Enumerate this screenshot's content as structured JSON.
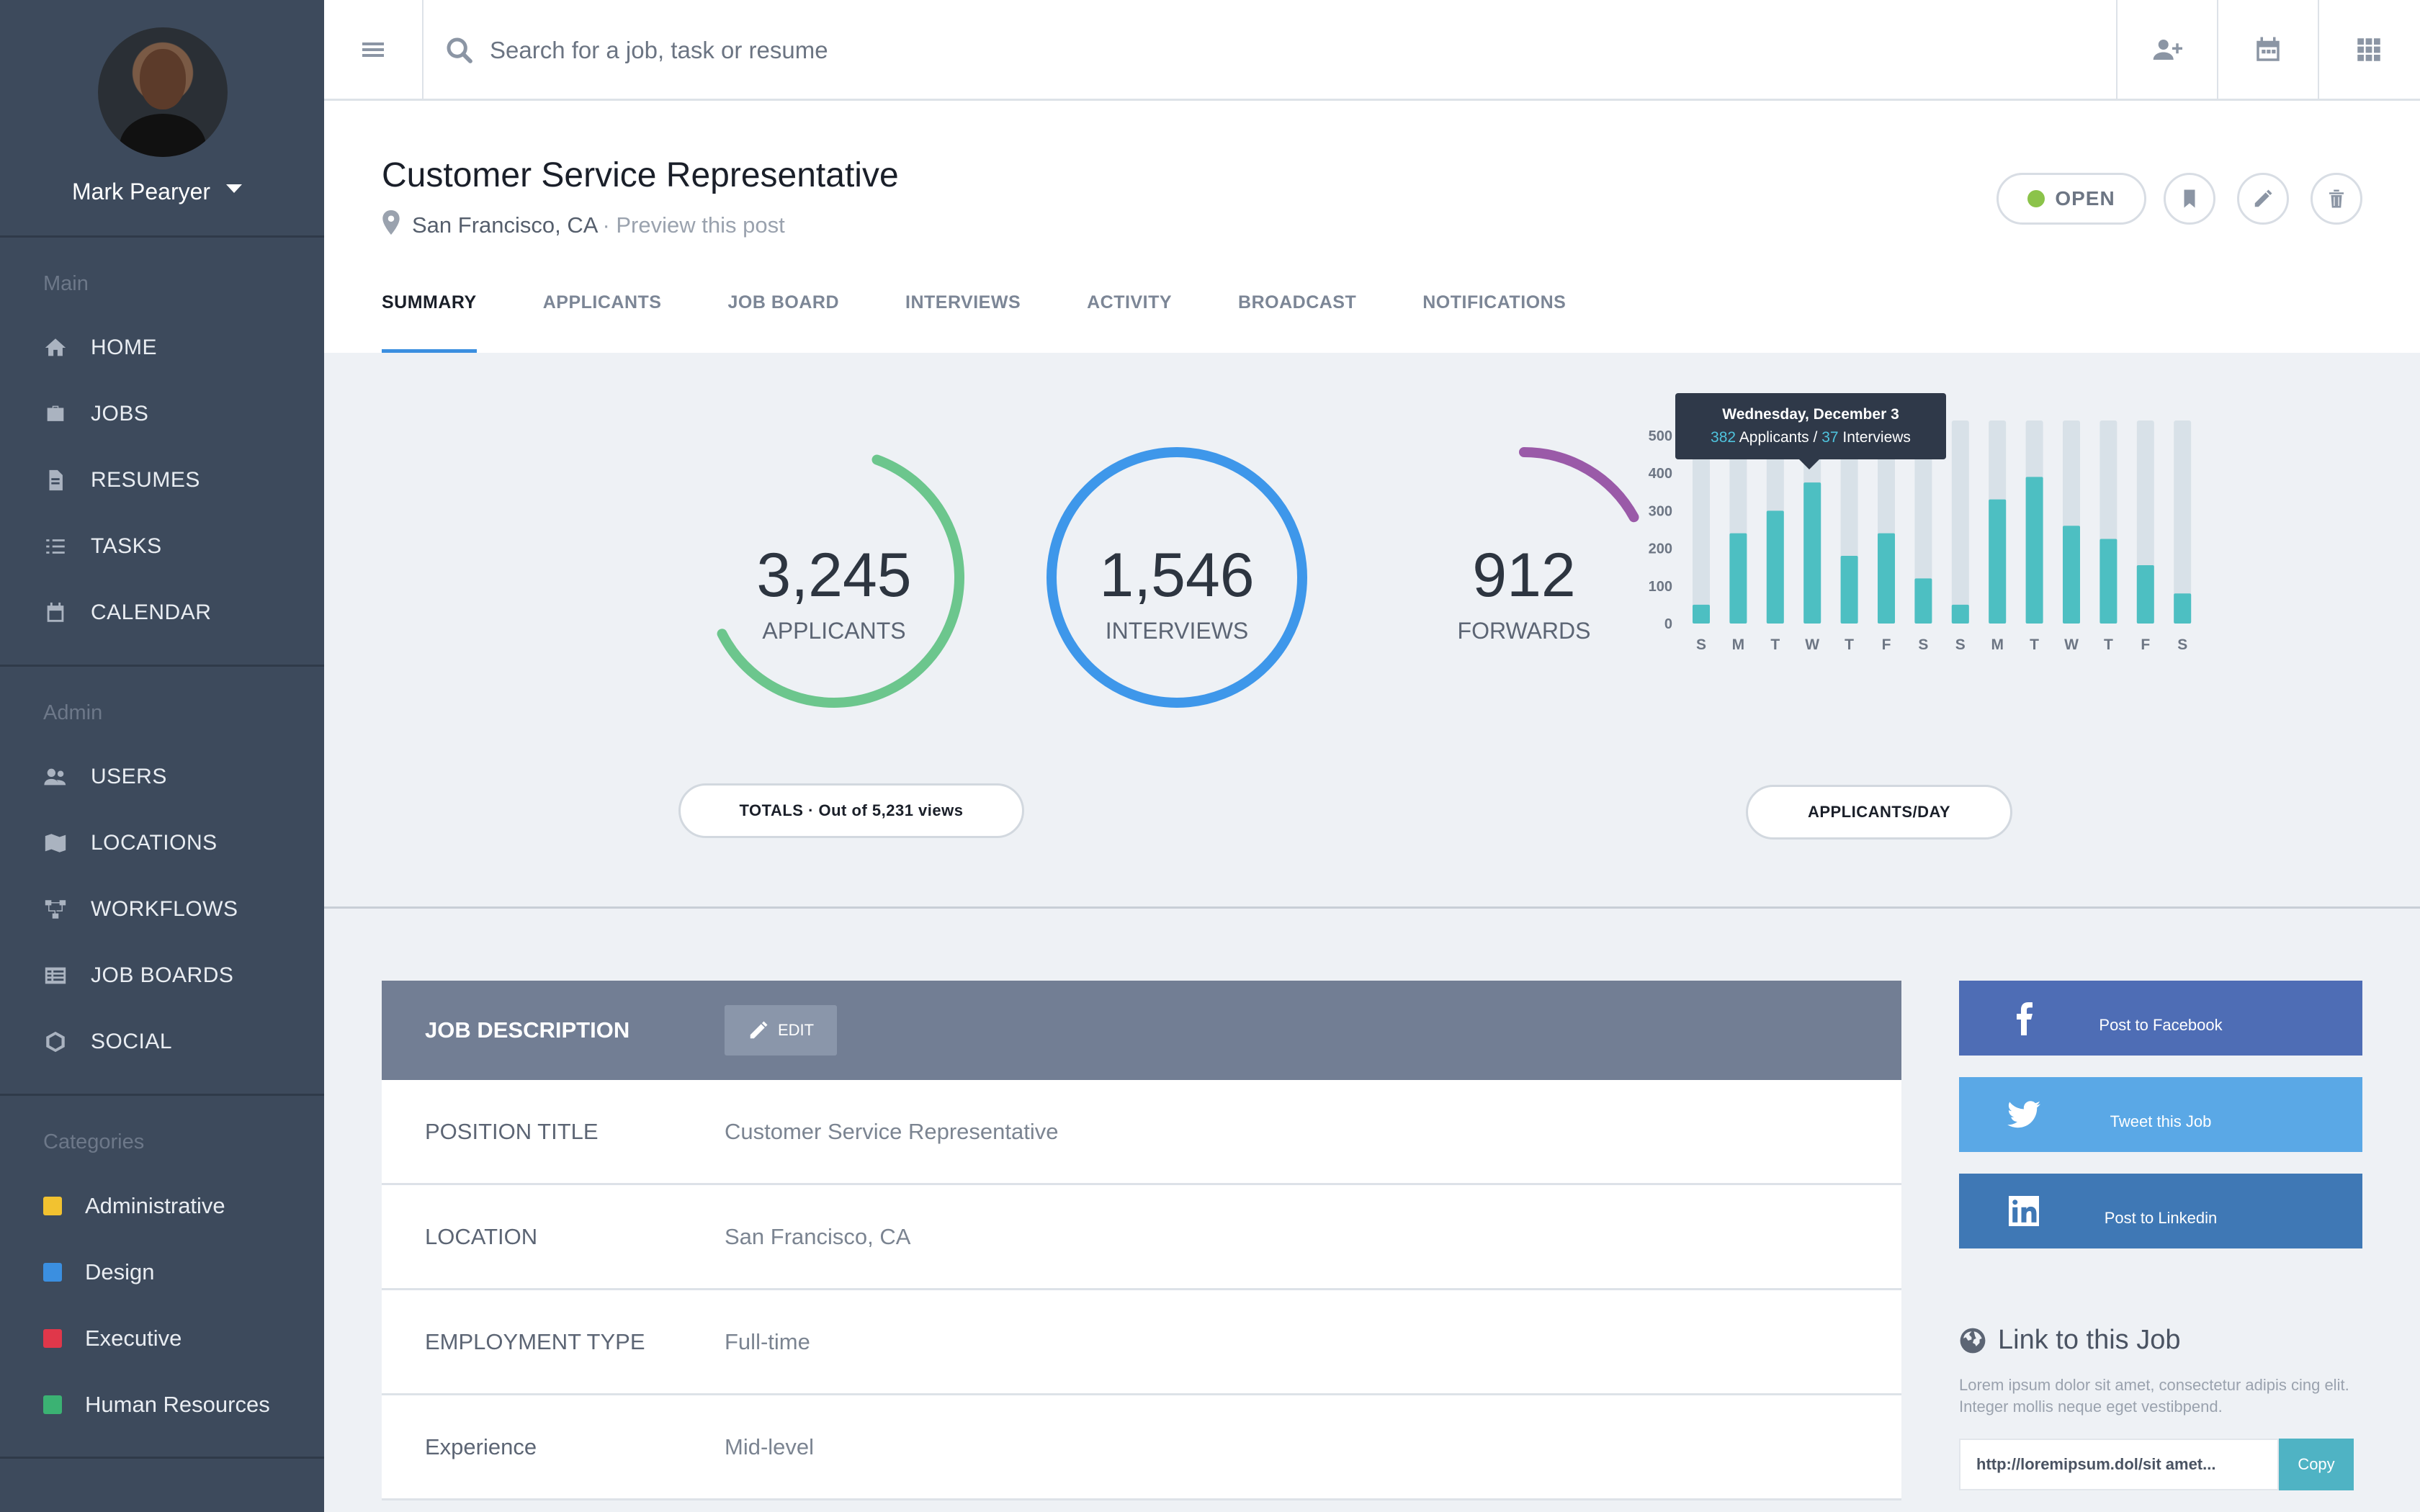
{
  "sidebar": {
    "user_name": "Mark Pearyer",
    "sections": [
      {
        "heading": "Main",
        "items": [
          {
            "label": "HOME",
            "icon": "home-icon"
          },
          {
            "label": "JOBS",
            "icon": "briefcase-icon"
          },
          {
            "label": "RESUMES",
            "icon": "document-icon"
          },
          {
            "label": "TASKS",
            "icon": "checklist-icon"
          },
          {
            "label": "CALENDAR",
            "icon": "calendar-icon"
          }
        ]
      },
      {
        "heading": "Admin",
        "items": [
          {
            "label": "USERS",
            "icon": "users-icon"
          },
          {
            "label": "LOCATIONS",
            "icon": "map-icon"
          },
          {
            "label": "WORKFLOWS",
            "icon": "workflow-icon"
          },
          {
            "label": "JOB BOARDS",
            "icon": "board-icon"
          },
          {
            "label": "SOCIAL",
            "icon": "social-icon"
          }
        ]
      }
    ],
    "categories": {
      "heading": "Categories",
      "items": [
        {
          "label": "Administrative",
          "color": "#f2c230"
        },
        {
          "label": "Design",
          "color": "#3b8fe0"
        },
        {
          "label": "Executive",
          "color": "#e0374a"
        },
        {
          "label": "Human Resources",
          "color": "#3bb273"
        }
      ]
    }
  },
  "topbar": {
    "search_placeholder": "Search for a job, task or resume",
    "actions": [
      "add-user-icon",
      "calendar-icon",
      "apps-grid-icon"
    ]
  },
  "header": {
    "title": "Customer Service Representative",
    "location": "San Francisco, CA",
    "preview_link": "· Preview this post",
    "status": "OPEN",
    "status_color": "#8bc34a",
    "tabs": [
      "SUMMARY",
      "APPLICANTS",
      "JOB BOARD",
      "INTERVIEWS",
      "ACTIVITY",
      "BROADCAST",
      "NOTIFICATIONS"
    ],
    "active_tab": "SUMMARY"
  },
  "stats": {
    "applicants": {
      "value": "3,245",
      "label": "APPLICANTS",
      "fraction": 0.62,
      "color": "#6cc68d"
    },
    "interviews": {
      "value": "1,546",
      "label": "INTERVIEWS",
      "fraction": 1.0,
      "color": "#3e97ea"
    },
    "forwards": {
      "value": "912",
      "label": "FORWARDS",
      "fraction": 0.17,
      "color": "#9a5aa8"
    },
    "totals_pill": "TOTALS · Out of 5,231 views",
    "chart_pill": "APPLICANTS/DAY"
  },
  "chart_data": {
    "type": "bar",
    "categories": [
      "S",
      "M",
      "T",
      "W",
      "T",
      "F",
      "S",
      "S",
      "M",
      "T",
      "W",
      "T",
      "F",
      "S"
    ],
    "values": [
      50,
      240,
      300,
      375,
      180,
      240,
      120,
      50,
      330,
      390,
      260,
      225,
      155,
      80
    ],
    "ylim": [
      0,
      540
    ],
    "yticks": [
      0,
      100,
      200,
      300,
      400,
      500
    ],
    "bar_color": "#4dbfc2",
    "track_color": "#d8e1e8",
    "tooltip": {
      "date": "Wednesday, December 3",
      "applicants": "382",
      "applicants_label": "Applicants",
      "separator": "/",
      "interviews": "37",
      "interviews_label": "Interviews"
    }
  },
  "description": {
    "heading": "JOB DESCRIPTION",
    "edit_label": "EDIT",
    "rows": [
      {
        "label": "POSITION TITLE",
        "value": "Customer Service Representative"
      },
      {
        "label": "LOCATION",
        "value": "San Francisco, CA"
      },
      {
        "label": "EMPLOYMENT TYPE",
        "value": "Full-time"
      },
      {
        "label": "Experience",
        "value": "Mid-level"
      }
    ]
  },
  "share": {
    "buttons": [
      {
        "label": "Post to Facebook",
        "color": "#4e6db5",
        "icon": "facebook-icon"
      },
      {
        "label": "Tweet this Job",
        "color": "#5aa8e6",
        "icon": "twitter-icon"
      },
      {
        "label": "Post to Linkedin",
        "color": "#3f78b5",
        "icon": "linkedin-icon"
      }
    ],
    "link_title": "Link to this Job",
    "link_desc": "Lorem ipsum dolor sit amet, consectetur adipis cing elit. Integer mollis neque eget vestibpend.",
    "link_url": "http://loremipsum.dol/sit amet...",
    "copy_label": "Copy"
  }
}
